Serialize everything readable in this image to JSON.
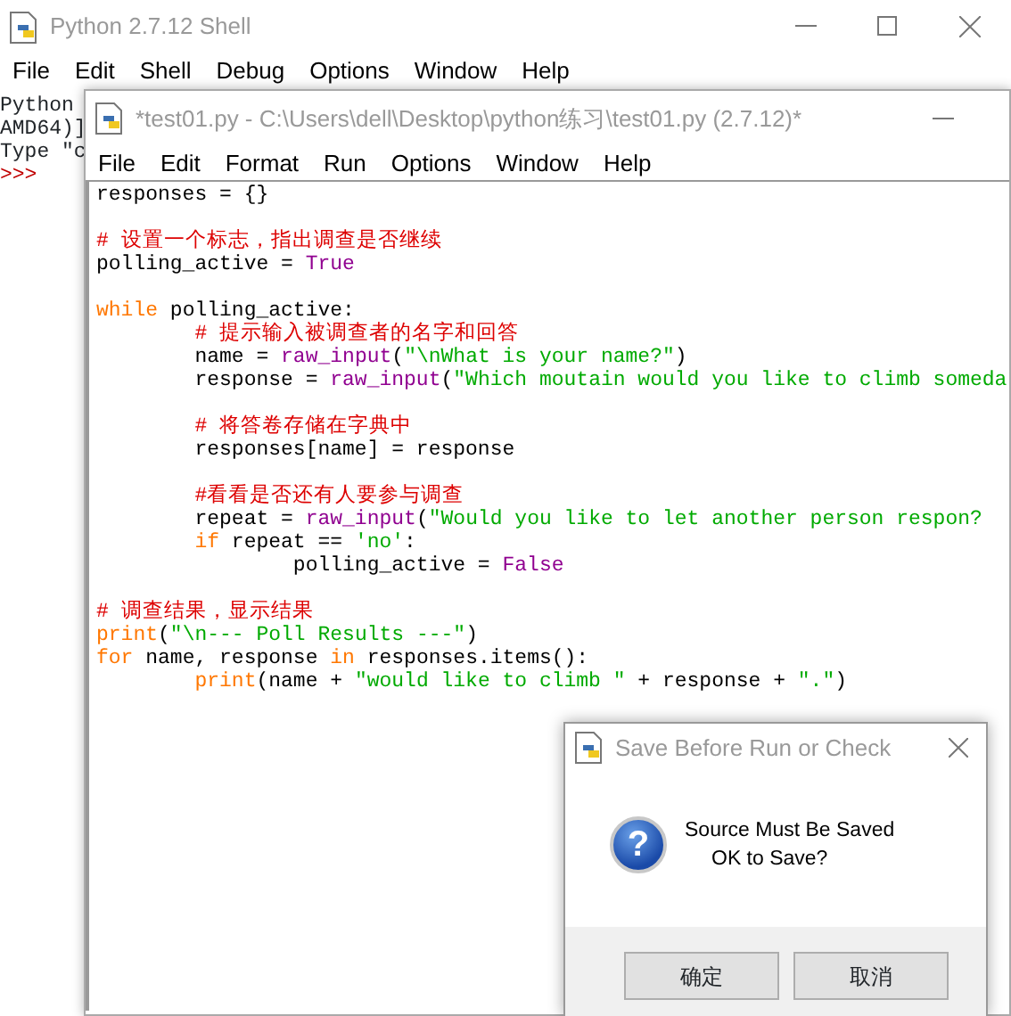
{
  "shell": {
    "title": "Python 2.7.12 Shell",
    "menu": [
      "File",
      "Edit",
      "Shell",
      "Debug",
      "Options",
      "Window",
      "Help"
    ],
    "output": [
      "Python",
      "AMD64)]",
      "Type \"c"
    ],
    "prompt": ">>>"
  },
  "editor": {
    "title": "*test01.py - C:\\Users\\dell\\Desktop\\python练习\\test01.py (2.7.12)*",
    "menu": [
      "File",
      "Edit",
      "Format",
      "Run",
      "Options",
      "Window",
      "Help"
    ],
    "code": [
      {
        "kind": "code",
        "segments": [
          {
            "kind": "plain",
            "text": "responses = {}"
          }
        ]
      },
      {
        "kind": "blank"
      },
      {
        "kind": "code",
        "segments": [
          {
            "kind": "comment",
            "text": "# 设置一个标志，指出调查是否继续"
          }
        ]
      },
      {
        "kind": "code",
        "segments": [
          {
            "kind": "plain",
            "text": "polling_active = "
          },
          {
            "kind": "builtin",
            "text": "True"
          }
        ]
      },
      {
        "kind": "blank"
      },
      {
        "kind": "code",
        "segments": [
          {
            "kind": "keyword",
            "text": "while"
          },
          {
            "kind": "plain",
            "text": " polling_active:"
          }
        ]
      },
      {
        "kind": "code",
        "segments": [
          {
            "kind": "comment",
            "text": "        # 提示输入被调查者的名字和回答"
          }
        ]
      },
      {
        "kind": "code",
        "segments": [
          {
            "kind": "plain",
            "text": "        name = "
          },
          {
            "kind": "builtin",
            "text": "raw_input"
          },
          {
            "kind": "plain",
            "text": "("
          },
          {
            "kind": "string",
            "text": "\"\\nWhat is your name?\""
          },
          {
            "kind": "plain",
            "text": ")"
          }
        ]
      },
      {
        "kind": "code",
        "segments": [
          {
            "kind": "plain",
            "text": "        response = "
          },
          {
            "kind": "builtin",
            "text": "raw_input"
          },
          {
            "kind": "plain",
            "text": "("
          },
          {
            "kind": "string",
            "text": "\"Which moutain would you like to climb someda"
          }
        ]
      },
      {
        "kind": "blank"
      },
      {
        "kind": "code",
        "segments": [
          {
            "kind": "comment",
            "text": "        # 将答卷存储在字典中"
          }
        ]
      },
      {
        "kind": "code",
        "segments": [
          {
            "kind": "plain",
            "text": "        responses[name] = response"
          }
        ]
      },
      {
        "kind": "blank"
      },
      {
        "kind": "code",
        "segments": [
          {
            "kind": "comment",
            "text": "        #看看是否还有人要参与调查"
          }
        ]
      },
      {
        "kind": "code",
        "segments": [
          {
            "kind": "plain",
            "text": "        repeat = "
          },
          {
            "kind": "builtin",
            "text": "raw_input"
          },
          {
            "kind": "plain",
            "text": "("
          },
          {
            "kind": "string",
            "text": "\"Would you like to let another person respon?"
          }
        ]
      },
      {
        "kind": "code",
        "segments": [
          {
            "kind": "keyword",
            "text": "        if"
          },
          {
            "kind": "plain",
            "text": " repeat == "
          },
          {
            "kind": "string",
            "text": "'no'"
          },
          {
            "kind": "plain",
            "text": ":"
          }
        ]
      },
      {
        "kind": "code",
        "segments": [
          {
            "kind": "plain",
            "text": "                polling_active = "
          },
          {
            "kind": "builtin",
            "text": "False"
          }
        ]
      },
      {
        "kind": "blank"
      },
      {
        "kind": "code",
        "segments": [
          {
            "kind": "comment",
            "text": "# 调查结果，显示结果"
          }
        ]
      },
      {
        "kind": "code",
        "segments": [
          {
            "kind": "keyword",
            "text": "print"
          },
          {
            "kind": "plain",
            "text": "("
          },
          {
            "kind": "string",
            "text": "\"\\n--- Poll Results ---\""
          },
          {
            "kind": "plain",
            "text": ")"
          }
        ]
      },
      {
        "kind": "code",
        "segments": [
          {
            "kind": "keyword",
            "text": "for"
          },
          {
            "kind": "plain",
            "text": " name, response "
          },
          {
            "kind": "keyword",
            "text": "in"
          },
          {
            "kind": "plain",
            "text": " responses.items():"
          }
        ]
      },
      {
        "kind": "code",
        "segments": [
          {
            "kind": "keyword",
            "text": "        print"
          },
          {
            "kind": "plain",
            "text": "(name + "
          },
          {
            "kind": "string",
            "text": "\"would like to climb \""
          },
          {
            "kind": "plain",
            "text": " + response + "
          },
          {
            "kind": "string",
            "text": "\".\""
          },
          {
            "kind": "plain",
            "text": ")"
          }
        ]
      }
    ]
  },
  "dialog": {
    "title": "Save Before Run or Check",
    "icon": "?",
    "message": [
      "Source Must Be Saved",
      "OK to Save?"
    ],
    "buttons": [
      "确定",
      "取消"
    ]
  }
}
